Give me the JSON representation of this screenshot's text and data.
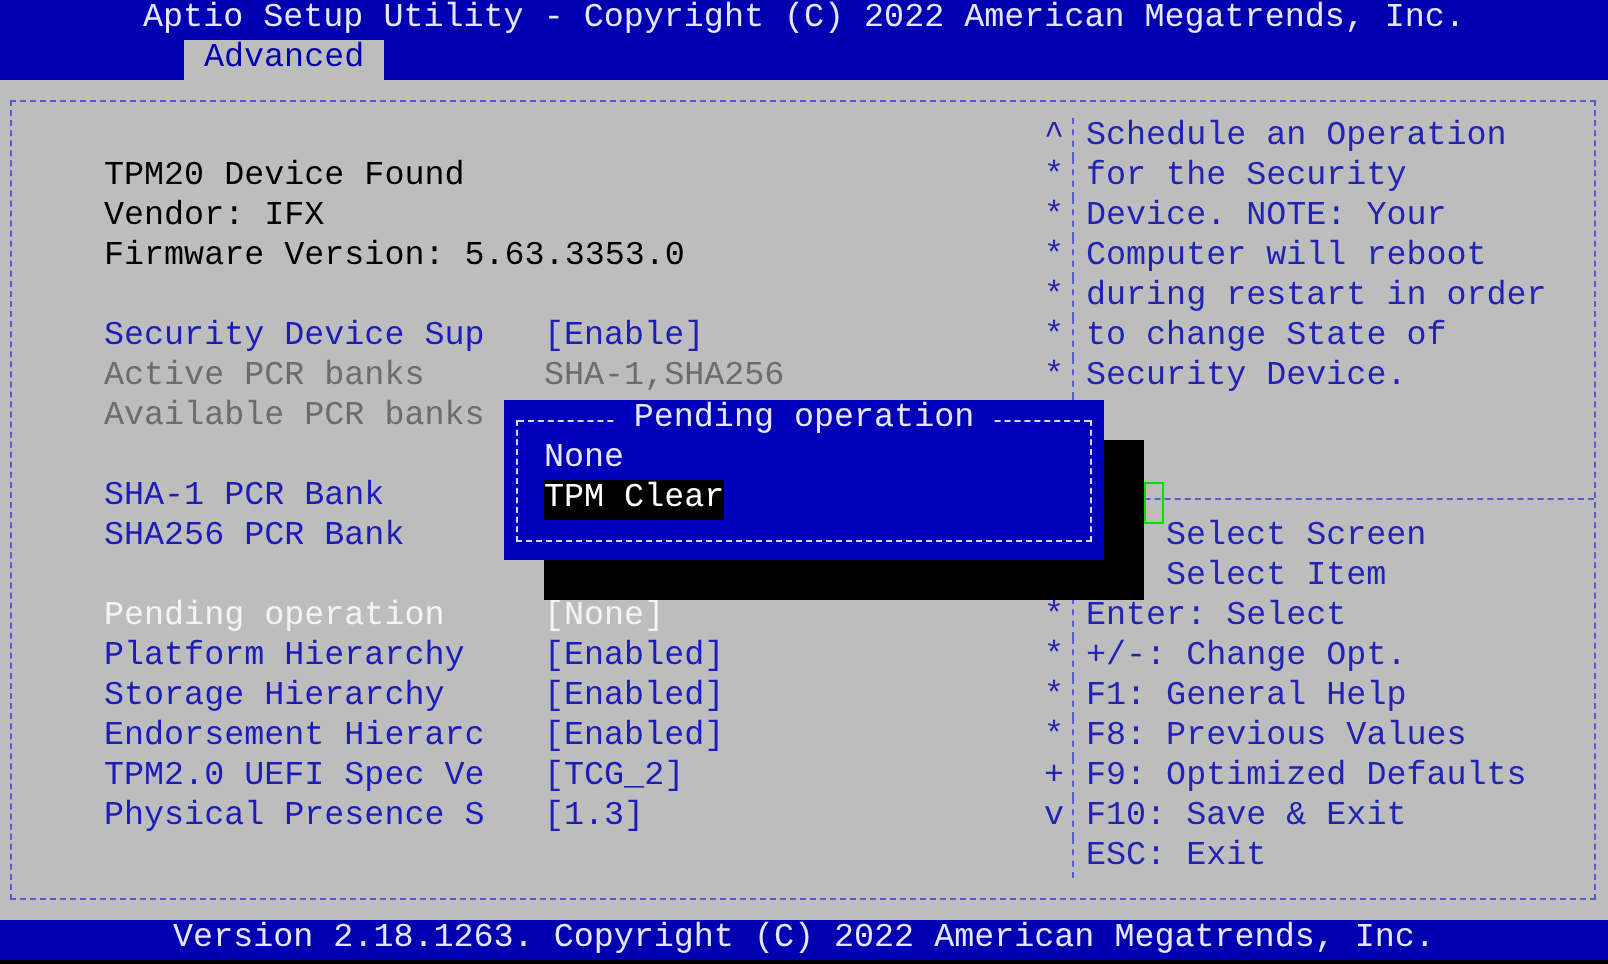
{
  "header": {
    "title": "Aptio Setup Utility - Copyright (C) 2022 American Megatrends, Inc."
  },
  "tabs": [
    {
      "label": "Advanced",
      "selected": true
    }
  ],
  "settings": {
    "groups": [
      [
        {
          "kind": "info",
          "label": "TPM20 Device Found",
          "selected": false
        },
        {
          "kind": "info",
          "label": "Vendor: IFX",
          "selected": false
        },
        {
          "kind": "info",
          "label": "Firmware Version: 5.63.3353.0",
          "selected": false
        }
      ],
      [
        {
          "kind": "setting",
          "label": "Security Device Sup",
          "value": "[Enable]",
          "selected": false
        },
        {
          "kind": "readonly",
          "label": "Active PCR banks",
          "value": "SHA-1,SHA256",
          "selected": false
        },
        {
          "kind": "readonly",
          "label": "Available PCR banks",
          "selected": false
        }
      ],
      [
        {
          "kind": "setting",
          "label": "SHA-1 PCR Bank",
          "selected": false
        },
        {
          "kind": "setting",
          "label": "SHA256 PCR Bank",
          "selected": false
        }
      ],
      [
        {
          "kind": "setting",
          "label": "Pending operation",
          "value": "[None]",
          "selected": true
        },
        {
          "kind": "setting",
          "label": "Platform Hierarchy",
          "value": "[Enabled]",
          "selected": false
        },
        {
          "kind": "setting",
          "label": "Storage Hierarchy",
          "value": "[Enabled]",
          "selected": false
        },
        {
          "kind": "setting",
          "label": "Endorsement Hierarc",
          "value": "[Enabled]",
          "selected": false
        },
        {
          "kind": "setting",
          "label": "TPM2.0 UEFI Spec Ve",
          "value": "[TCG_2]",
          "selected": false
        },
        {
          "kind": "setting",
          "label": "Physical Presence S",
          "value": "[1.3]",
          "selected": false
        }
      ]
    ]
  },
  "help": {
    "lines": [
      {
        "marker": "^",
        "text": "Schedule an Operation"
      },
      {
        "marker": "*",
        "text": "for the Security"
      },
      {
        "marker": "*",
        "text": "Device. NOTE: Your"
      },
      {
        "marker": "*",
        "text": "Computer will reboot"
      },
      {
        "marker": "*",
        "text": "during restart in order"
      },
      {
        "marker": "*",
        "text": "to change State of"
      },
      {
        "marker": "*",
        "text": "Security Device."
      }
    ],
    "keys": [
      {
        "kind": "partial",
        "text": "Select Screen"
      },
      {
        "kind": "partial",
        "text": "Select Item"
      },
      {
        "kind": "full",
        "marker": "*",
        "text": "Enter: Select"
      },
      {
        "kind": "full",
        "marker": "*",
        "text": "+/-: Change Opt."
      },
      {
        "kind": "full",
        "marker": "*",
        "text": "F1: General Help"
      },
      {
        "kind": "full",
        "marker": "*",
        "text": "F8: Previous Values"
      },
      {
        "kind": "full",
        "marker": "+",
        "text": "F9: Optimized Defaults"
      },
      {
        "kind": "full",
        "marker": "v",
        "text": "F10: Save & Exit"
      },
      {
        "kind": "full",
        "text": "ESC: Exit"
      }
    ]
  },
  "popup": {
    "title": "Pending operation",
    "options": [
      {
        "label": "None",
        "selected": false
      },
      {
        "label": "TPM Clear",
        "selected": true
      }
    ]
  },
  "footer": {
    "text": "Version 2.18.1263. Copyright (C) 2022 American Megatrends, Inc."
  }
}
